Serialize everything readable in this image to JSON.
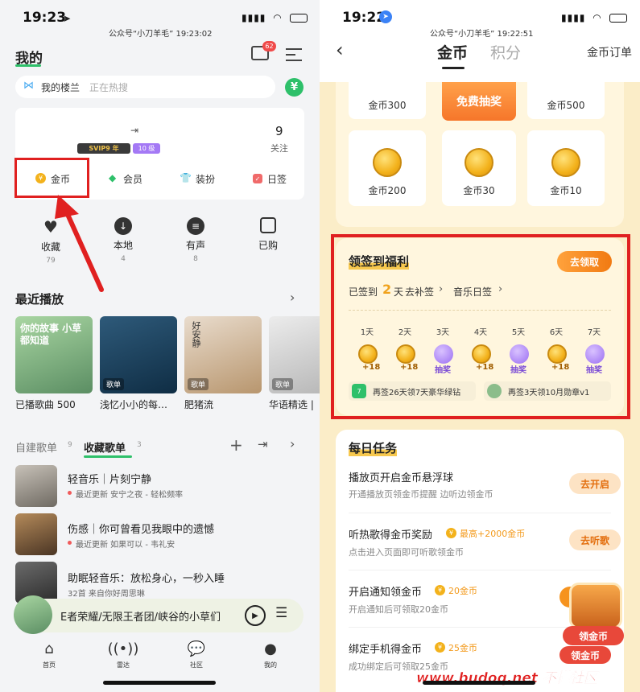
{
  "left": {
    "status": {
      "time": "19:23",
      "time_icon": "location-arrow-icon",
      "watermark": "公众号“小刀羊毛”   19:23:02"
    },
    "header": {
      "title": "我的",
      "mail_badge": "62"
    },
    "search": {
      "prefix": "我的楼兰",
      "placeholder": "正在热搜"
    },
    "profile": {
      "vip_label": "SVIP9 年",
      "level_label": "10 级",
      "follow_count": "9",
      "follow_label": "关注"
    },
    "quick": [
      {
        "label": "金币",
        "icon": "coin-icon"
      },
      {
        "label": "会员",
        "icon": "diamond-icon"
      },
      {
        "label": "装扮",
        "icon": "shirt-icon"
      },
      {
        "label": "日签",
        "icon": "calendar-icon"
      }
    ],
    "library": [
      {
        "label": "收藏",
        "count": "79",
        "icon": "heart-icon"
      },
      {
        "label": "本地",
        "count": "4",
        "icon": "download-icon"
      },
      {
        "label": "有声",
        "count": "8",
        "icon": "audiobook-icon"
      },
      {
        "label": "已购",
        "count": "",
        "icon": "shopping-bag-icon"
      }
    ],
    "recent": {
      "title": "最近播放",
      "cards": [
        {
          "caption": "已播歌曲 500",
          "badge": "",
          "cover_text": "你的故事 小草都知道"
        },
        {
          "caption": "浅忆小小的每…",
          "badge": "歌单",
          "cover_text": ""
        },
        {
          "caption": "肥猪流",
          "badge": "歌单",
          "cover_text": "好安静"
        },
        {
          "caption": "华语精选 |",
          "badge": "歌单",
          "cover_text": ""
        }
      ]
    },
    "playlist_tabs": {
      "self": "自建歌单",
      "self_count": "9",
      "fav": "收藏歌单",
      "fav_count": "3"
    },
    "playlists": [
      {
        "title": "轻音乐｜片刻宁静",
        "sub": "最近更新 安宁之夜 - 轻松频率"
      },
      {
        "title": "伤感｜你可曾看见我眼中的遗憾",
        "sub": "最近更新 如果可以 - 韦礼安"
      },
      {
        "title": "助眠轻音乐：放松身心，一秒入睡",
        "sub": "32首 来自你好周思琳"
      }
    ],
    "player": {
      "text": "E者荣耀/无限王者团/峡谷的小草们"
    },
    "nav": [
      {
        "label": "首页",
        "icon": "home-icon"
      },
      {
        "label": "雷达",
        "icon": "radar-icon"
      },
      {
        "label": "社区",
        "icon": "community-icon"
      },
      {
        "label": "我的",
        "icon": "user-icon"
      }
    ]
  },
  "right": {
    "status": {
      "time": "19:22",
      "watermark": "公众号“小刀羊毛”   19:22:51"
    },
    "header": {
      "tab_coin": "金币",
      "tab_points": "积分",
      "orders": "金币订单"
    },
    "coin_grid": [
      {
        "label": "金币300"
      },
      {
        "label": "免费抽奖"
      },
      {
        "label": "金币500"
      },
      {
        "label": "金币200"
      },
      {
        "label": "金币30"
      },
      {
        "label": "金币10"
      }
    ],
    "signin": {
      "title": "领签到福利",
      "button": "去领取",
      "signed_prefix": "已签到",
      "signed_days": "2",
      "signed_suffix": "天",
      "makeup": "去补签",
      "music_daily": "音乐日签",
      "days": [
        {
          "day": "1天",
          "reward": "+18"
        },
        {
          "day": "2天",
          "reward": "+18"
        },
        {
          "day": "3天",
          "reward": "抽奖"
        },
        {
          "day": "4天",
          "reward": "+18"
        },
        {
          "day": "5天",
          "reward": "抽奖"
        },
        {
          "day": "6天",
          "reward": "+18"
        },
        {
          "day": "7天",
          "reward": "抽奖"
        }
      ],
      "promo1": "再签26天领7天豪华绿钻",
      "promo2": "再签3天领10月勋章v1"
    },
    "daily": {
      "title": "每日任务",
      "tasks": [
        {
          "title": "播放页开启金币悬浮球",
          "reward": "",
          "sub": "开通播放页领金币提醒 边听边领金币",
          "button": "去开启"
        },
        {
          "title": "听热歌得金币奖励",
          "reward": "最高+2000金币",
          "sub": "点击进入页面即可听歌领金币",
          "button": "去听歌"
        },
        {
          "title": "开启通知领金币",
          "reward": "20金币",
          "sub": "开启通知后可领取20金币",
          "button": "立即"
        },
        {
          "title": "绑定手机得金币",
          "reward": "25金币",
          "sub": "成功绑定后可领取25金币",
          "button": ""
        }
      ]
    },
    "float": {
      "label": "领金币",
      "label2": "领金币"
    },
    "site_watermark": "www.budoq.net 不懂社区"
  },
  "colors": {
    "highlight_red": "#e02020",
    "orange": "#f18a1c",
    "green": "#2ec06a",
    "cream": "#fbedc8"
  }
}
